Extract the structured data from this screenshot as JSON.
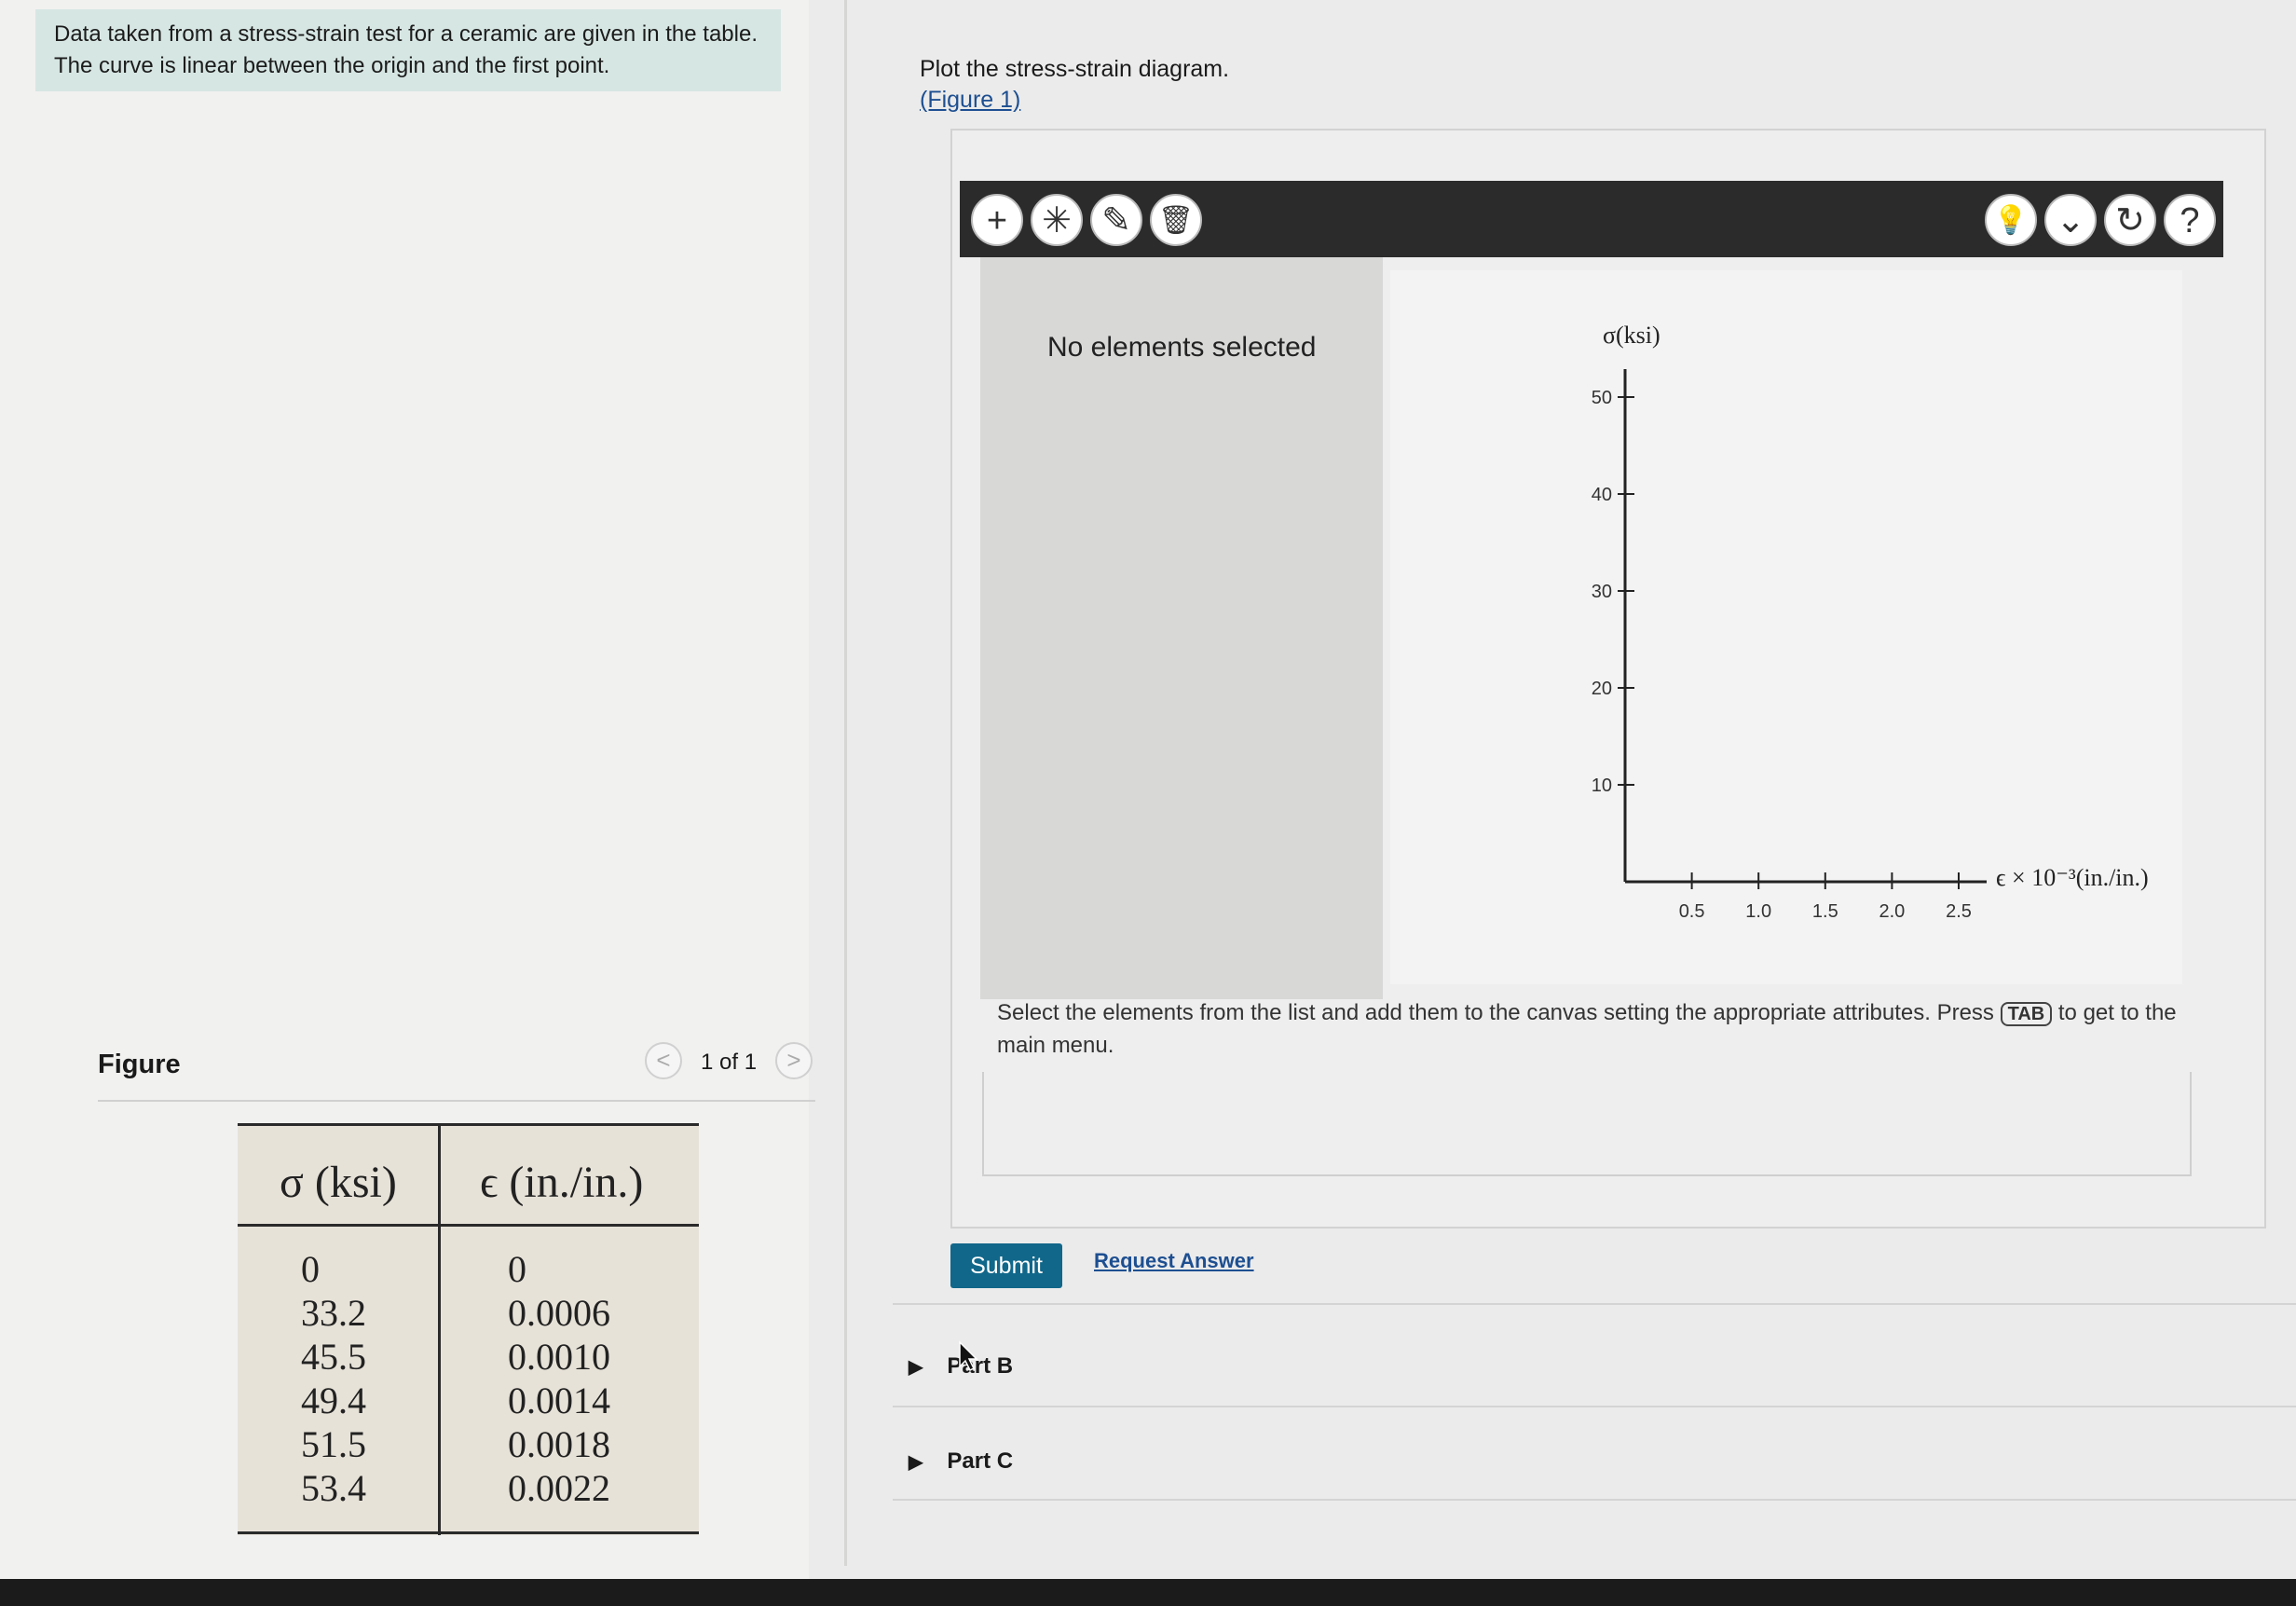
{
  "problem": {
    "text": "Data taken from a stress-strain test for a ceramic are given in the table. The curve is linear between the origin and the first point."
  },
  "figure": {
    "label": "Figure",
    "pager": "1 of 1",
    "prev_glyph": "<",
    "next_glyph": ">",
    "table": {
      "headers": [
        "σ (ksi)",
        "ϵ (in./in.)"
      ],
      "sigma": [
        "0",
        "33.2",
        "45.5",
        "49.4",
        "51.5",
        "53.4"
      ],
      "epsilon": [
        "0",
        "0.0006",
        "0.0010",
        "0.0014",
        "0.0018",
        "0.0022"
      ]
    }
  },
  "part_a": {
    "instruction": "Plot the stress-strain diagram.",
    "figure_link": "(Figure 1)"
  },
  "toolbar": {
    "left_icons": [
      "add-icon",
      "asterisk-icon",
      "edit-icon",
      "trash-icon"
    ],
    "right_icons": [
      "hint-icon",
      "chevron-down-icon",
      "reset-icon",
      "help-icon"
    ],
    "glyphs": {
      "add": "+",
      "asterisk": "✳",
      "edit": "✎",
      "trash": "🗑",
      "hint": "💡",
      "chevron": "⌄",
      "reset": "↻",
      "help": "?"
    }
  },
  "panel": {
    "no_elements": "No elements selected"
  },
  "chart_data": {
    "type": "line",
    "ylabel": "σ(ksi)",
    "xlabel": "ϵ × 10⁻³(in./in.)",
    "yticks": [
      "10",
      "20",
      "30",
      "40",
      "50"
    ],
    "xticks": [
      "0.5",
      "1.0",
      "1.5",
      "2.0",
      "2.5"
    ],
    "ylim": [
      0,
      50
    ],
    "xlim": [
      0,
      2.5
    ],
    "series": []
  },
  "instructions": {
    "before": "Select the elements from the list and add them to the canvas setting the appropriate attributes. Press",
    "key": "TAB",
    "after": "to get to the main menu."
  },
  "actions": {
    "submit": "Submit",
    "request_answer": "Request Answer"
  },
  "parts": [
    {
      "label": "Part B"
    },
    {
      "label": "Part C"
    }
  ],
  "colors": {
    "submit_bg": "#11678a",
    "link": "#1d4f91",
    "problem_bg": "#d6e6e3",
    "toolbar_bg": "#2b2b2b"
  }
}
